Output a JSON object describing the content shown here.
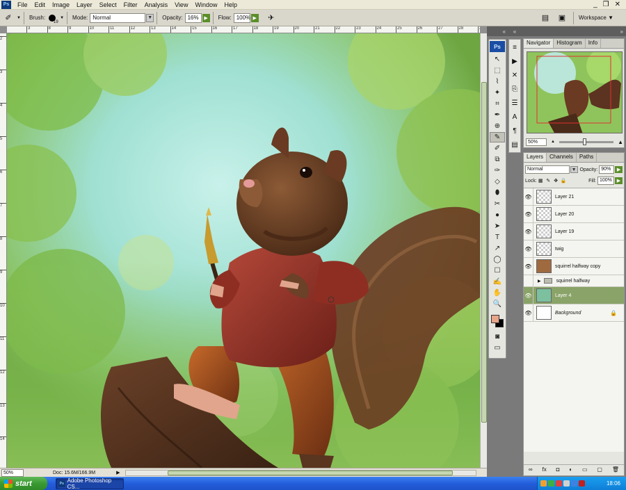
{
  "app": {
    "logo": "Ps"
  },
  "menu": [
    "File",
    "Edit",
    "Image",
    "Layer",
    "Select",
    "Filter",
    "Analysis",
    "View",
    "Window",
    "Help"
  ],
  "window_controls": [
    "_",
    "❐",
    "✕"
  ],
  "options": {
    "brush_label": "Brush:",
    "brush_size": "19",
    "mode_label": "Mode:",
    "mode_value": "Normal",
    "opacity_label": "Opacity:",
    "opacity_value": "16%",
    "flow_label": "Flow:",
    "flow_value": "100%",
    "workspace_label": "Workspace ▼"
  },
  "ruler": {
    "top": [
      "3",
      "8",
      "9",
      "10",
      "11",
      "12",
      "13",
      "14",
      "15",
      "16",
      "17",
      "18",
      "19",
      "20",
      "21",
      "22",
      "23",
      "24",
      "25",
      "26",
      "27",
      "28",
      "29"
    ],
    "left": [
      "2",
      "3",
      "4",
      "5",
      "6",
      "7",
      "8",
      "9",
      "10",
      "11",
      "12",
      "13",
      "14"
    ]
  },
  "status": {
    "zoom": "50%",
    "doc": "Doc: 15.6M/166.9M",
    "arrow": "▶"
  },
  "tools": [
    "↖",
    "⬚",
    "⌇",
    "✦",
    "⌗",
    "✒",
    "⊕",
    "✎",
    "✐",
    "⧉",
    "✑",
    "◇",
    "⬮",
    "✂",
    "●",
    "➤",
    "T",
    "↗",
    "◯",
    "☐",
    "✍",
    "✋",
    "🔍"
  ],
  "strip_buttons": [
    "≡",
    "▶",
    "✕",
    "⎘",
    "☰",
    "A",
    "¶",
    "▤"
  ],
  "colors": {
    "foreground": "#e8a58a",
    "background": "#000000",
    "accent": "#8aa368"
  },
  "navigator": {
    "tabs": [
      "Navigator",
      "Histogram",
      "Info"
    ],
    "zoom": "50%",
    "zoom_out": "▲",
    "zoom_in": "▲"
  },
  "layers": {
    "tabs": [
      "Layers",
      "Channels",
      "Paths"
    ],
    "blend_mode": "Normal",
    "opacity_label": "Opacity:",
    "opacity": "90%",
    "lock_label": "Lock:",
    "fill_label": "Fill:",
    "fill": "100%",
    "items": [
      {
        "name": "Layer 21"
      },
      {
        "name": "Layer 20"
      },
      {
        "name": "Layer 19"
      },
      {
        "name": "twig"
      },
      {
        "name": "squirrel halfway copy"
      },
      {
        "name": "squirrel halfway"
      },
      {
        "name": "Layer 4"
      },
      {
        "name": "Background"
      }
    ],
    "footer": [
      "∞",
      "fx",
      "◘",
      "◐",
      "▭",
      "▢",
      "🗑"
    ]
  },
  "taskbar": {
    "start": "start",
    "task": "Adobe Photoshop CS...",
    "clock": "18:06"
  }
}
